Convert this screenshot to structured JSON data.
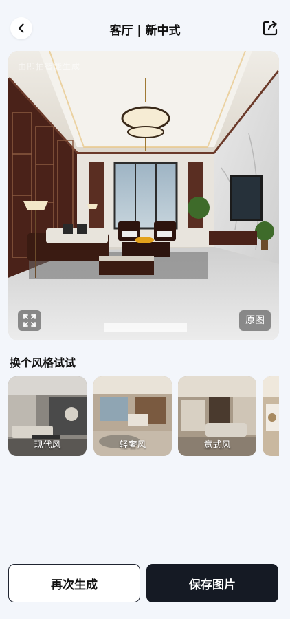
{
  "header": {
    "title": "客厅 | 新中式"
  },
  "hero": {
    "watermark": "由即拍智能生成",
    "original_label": "原图"
  },
  "styles_section": {
    "title": "换个风格试试",
    "items": [
      {
        "label": "现代风"
      },
      {
        "label": "轻奢风"
      },
      {
        "label": "意式风"
      },
      {
        "label": ""
      }
    ]
  },
  "actions": {
    "regenerate_label": "再次生成",
    "save_label": "保存图片"
  },
  "colors": {
    "primary_button": "#151a24",
    "background": "#f3f6fb"
  }
}
